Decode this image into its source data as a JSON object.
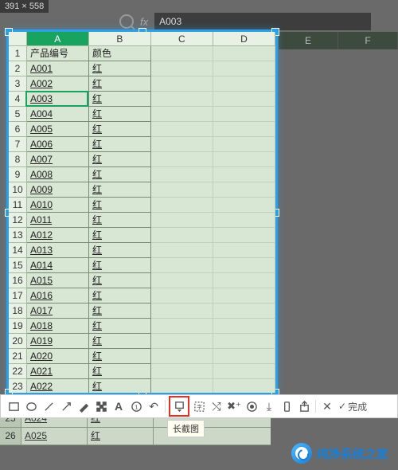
{
  "capture_dimensions": "391 × 558",
  "formula_bar": {
    "fx_label": "fx",
    "value": "A003",
    "active_cell_ref": "A4"
  },
  "outside_cols": [
    "E",
    "F"
  ],
  "columns": [
    "A",
    "B",
    "C",
    "D"
  ],
  "active_column": "A",
  "headers": {
    "A": "产品编号",
    "B": "颜色"
  },
  "active_cell": {
    "row": 4,
    "col": "A"
  },
  "rows": [
    {
      "n": 1,
      "A": "产品编号",
      "B": "颜色"
    },
    {
      "n": 2,
      "A": "A001",
      "B": "红"
    },
    {
      "n": 3,
      "A": "A002",
      "B": "红"
    },
    {
      "n": 4,
      "A": "A003",
      "B": "红"
    },
    {
      "n": 5,
      "A": "A004",
      "B": "红"
    },
    {
      "n": 6,
      "A": "A005",
      "B": "红"
    },
    {
      "n": 7,
      "A": "A006",
      "B": "红"
    },
    {
      "n": 8,
      "A": "A007",
      "B": "红"
    },
    {
      "n": 9,
      "A": "A008",
      "B": "红"
    },
    {
      "n": 10,
      "A": "A009",
      "B": "红"
    },
    {
      "n": 11,
      "A": "A010",
      "B": "红"
    },
    {
      "n": 12,
      "A": "A011",
      "B": "红"
    },
    {
      "n": 13,
      "A": "A012",
      "B": "红"
    },
    {
      "n": 14,
      "A": "A013",
      "B": "红"
    },
    {
      "n": 15,
      "A": "A014",
      "B": "红"
    },
    {
      "n": 16,
      "A": "A015",
      "B": "红"
    },
    {
      "n": 17,
      "A": "A016",
      "B": "红"
    },
    {
      "n": 18,
      "A": "A017",
      "B": "红"
    },
    {
      "n": 19,
      "A": "A018",
      "B": "红"
    },
    {
      "n": 20,
      "A": "A019",
      "B": "红"
    },
    {
      "n": 21,
      "A": "A020",
      "B": "红"
    },
    {
      "n": 22,
      "A": "A021",
      "B": "红"
    },
    {
      "n": 23,
      "A": "A022",
      "B": "红"
    }
  ],
  "bottom_rows": [
    {
      "n": 25,
      "A": "A024",
      "B": "红"
    },
    {
      "n": 26,
      "A": "A025",
      "B": "红"
    }
  ],
  "toolbar": {
    "items": [
      {
        "name": "rect-tool",
        "icon": "rect"
      },
      {
        "name": "ellipse-tool",
        "icon": "ellipse"
      },
      {
        "name": "line-tool",
        "icon": "line"
      },
      {
        "name": "arrow-tool",
        "icon": "arrow"
      },
      {
        "name": "brush-tool",
        "icon": "brush"
      },
      {
        "name": "mosaic-tool",
        "icon": "mosaic"
      },
      {
        "name": "text-tool",
        "icon": "text"
      },
      {
        "name": "number-tool",
        "icon": "number"
      },
      {
        "name": "undo-tool",
        "icon": "undo"
      },
      {
        "name": "sep"
      },
      {
        "name": "long-screenshot-tool",
        "icon": "longshot",
        "highlight": true
      },
      {
        "name": "ocr-tool",
        "icon": "ocr"
      },
      {
        "name": "shuffle-tool",
        "icon": "shuffle"
      },
      {
        "name": "pin-tool",
        "icon": "pin"
      },
      {
        "name": "record-tool",
        "icon": "record"
      },
      {
        "name": "download-tool",
        "icon": "download"
      },
      {
        "name": "phone-tool",
        "icon": "phone"
      },
      {
        "name": "share-tool",
        "icon": "share"
      },
      {
        "name": "sep"
      },
      {
        "name": "close-tool",
        "icon": "close"
      },
      {
        "name": "done-tool",
        "icon": "check",
        "label": "完成"
      }
    ]
  },
  "tooltip": "长截图",
  "watermark": "纯净系统之家"
}
